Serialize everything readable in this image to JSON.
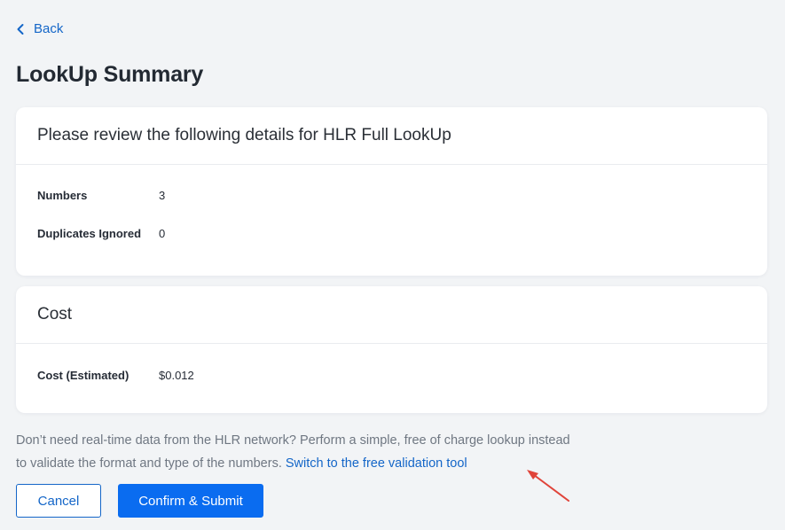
{
  "nav": {
    "back_label": "Back"
  },
  "page": {
    "title": "LookUp Summary"
  },
  "details_card": {
    "heading": "Please review the following details for HLR Full LookUp",
    "rows": [
      {
        "label": "Numbers",
        "value": "3"
      },
      {
        "label": "Duplicates Ignored",
        "value": "0"
      }
    ]
  },
  "cost_card": {
    "heading": "Cost",
    "rows": [
      {
        "label": "Cost (Estimated)",
        "value": "$0.012"
      }
    ]
  },
  "note": {
    "text": "Don’t need real-time data from the HLR network? Perform a simple, free of charge lookup instead to validate the format and type of the numbers. ",
    "link_label": "Switch to the free validation tool"
  },
  "actions": {
    "cancel_label": "Cancel",
    "confirm_label": "Confirm & Submit"
  },
  "colors": {
    "accent": "#1466c8",
    "primary_button": "#0a6cf0",
    "annotation_arrow": "#e0443a",
    "background": "#f2f4f6"
  },
  "icons": {
    "back": "chevron-left-icon",
    "annotation": "arrow-annotation-icon"
  }
}
